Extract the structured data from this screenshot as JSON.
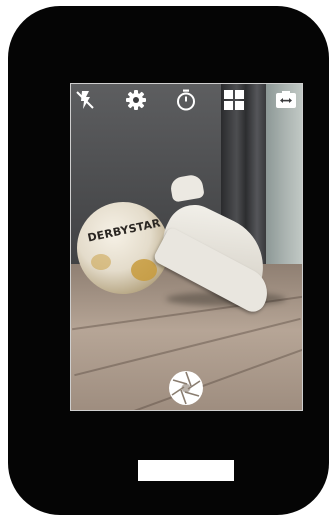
{
  "viewfinder": {
    "ball_print": "DERBYSTAR"
  },
  "controls": {
    "flash": {
      "icon": "flash-off-icon"
    },
    "settings": {
      "icon": "gear-icon"
    },
    "timer": {
      "icon": "timer-icon"
    },
    "grid": {
      "icon": "grid-icon"
    },
    "switch_camera": {
      "icon": "switch-camera-icon"
    },
    "shutter": {
      "icon": "aperture-icon"
    }
  },
  "colors": {
    "device": "#050505",
    "icon": "#ffffff",
    "home_indicator": "#ffffff"
  }
}
